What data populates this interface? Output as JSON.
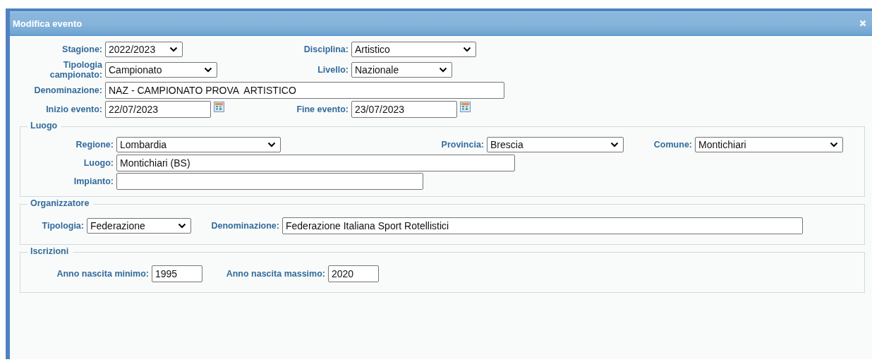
{
  "dialog": {
    "title": "Modifica evento"
  },
  "main_fields": [
    {
      "label": "Stagione:",
      "kind": "select",
      "value": "2022/2023"
    },
    {
      "label": "Disciplina:",
      "kind": "select",
      "value": "Artistico"
    },
    {
      "label": "Tipologia campionato:",
      "kind": "select",
      "value": "Campionato"
    },
    {
      "label": "Livello:",
      "kind": "select",
      "value": "Nazionale"
    },
    {
      "label": "Denominazione:",
      "kind": "input",
      "value": "NAZ - CAMPIONATO PROVA  ARTISTICO"
    },
    {
      "label": "Inizio evento:",
      "kind": "date",
      "value": "22/07/2023"
    },
    {
      "label": "Fine evento:",
      "kind": "date",
      "value": "23/07/2023"
    }
  ],
  "luogo": {
    "legend": "Luogo",
    "fields": [
      {
        "label": "Regione:",
        "kind": "select",
        "value": "Lombardia"
      },
      {
        "label": "Provincia:",
        "kind": "select",
        "value": "Brescia"
      },
      {
        "label": "Comune:",
        "kind": "select",
        "value": "Montichiari"
      },
      {
        "label": "Luogo:",
        "kind": "input",
        "value": "Montichiari (BS)"
      },
      {
        "label": "Impianto:",
        "kind": "input"
      }
    ]
  },
  "organizzatore": {
    "legend": "Organizzatore",
    "fields": [
      {
        "label": "Tipologia:",
        "kind": "select",
        "value": "Federazione"
      },
      {
        "label": "Denominazione:",
        "kind": "input",
        "value": "Federazione Italiana Sport Rotellistici"
      }
    ]
  },
  "iscrizioni": {
    "legend": "Iscrizioni",
    "fields": [
      {
        "label": "Anno nascita minimo:",
        "kind": "input",
        "value": "1995"
      },
      {
        "label": "Anno nascita massimo:",
        "kind": "input",
        "value": "2020"
      }
    ]
  }
}
